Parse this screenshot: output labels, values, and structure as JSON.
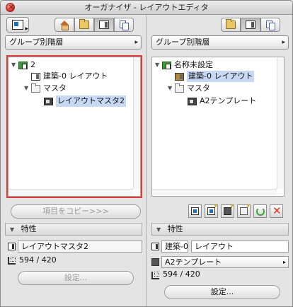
{
  "window": {
    "title": "オーガナイザ - レイアウトエディタ"
  },
  "left": {
    "dropdown_label": "グループ別階層",
    "tree": [
      {
        "label": "2",
        "icon": "book-icon",
        "depth": 0,
        "expanded": true
      },
      {
        "label": "建築-0 レイアウト",
        "icon": "layout-sheet-icon",
        "depth": 1
      },
      {
        "label": "マスタ",
        "icon": "folder-icon",
        "depth": 1,
        "expanded": true
      },
      {
        "label": "レイアウトマスタ2",
        "icon": "master-icon",
        "depth": 2,
        "selected": true
      }
    ],
    "copy_button": "項目をコピー>>>",
    "properties_header": "特性",
    "name_field": "レイアウトマスタ2",
    "size_text": "594 / 420",
    "settings_button": "設定..."
  },
  "right": {
    "dropdown_label": "グループ別階層",
    "tree": [
      {
        "label": "名称未設定",
        "icon": "book-icon",
        "depth": 0,
        "expanded": true
      },
      {
        "label": "建築-0 レイアウト",
        "icon": "layout-sheet-icon",
        "depth": 1,
        "selected": true
      },
      {
        "label": "マスタ",
        "icon": "folder-icon",
        "depth": 1,
        "expanded": true
      },
      {
        "label": "A2テンプレート",
        "icon": "master-icon",
        "depth": 2
      }
    ],
    "properties_header": "特性",
    "id_field": "建築-0",
    "name_field": "レイアウト",
    "master_select": "A2テンプレート",
    "size_text": "594 / 420",
    "settings_button": "設定..."
  }
}
